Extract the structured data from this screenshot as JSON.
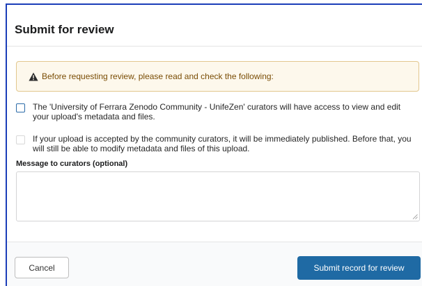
{
  "modal": {
    "title": "Submit for review"
  },
  "warning": {
    "icon": "warning-triangle-icon",
    "text": "Before requesting review, please read and check the following:",
    "colors": {
      "background": "#fdf8ec",
      "border": "#e2c78e",
      "text": "#7a4d05"
    }
  },
  "checks": [
    {
      "text": "The 'University of Ferrara Zenodo Community - UnifeZen' curators will have access to view and edit your upload's metadata and files.",
      "checked": false,
      "enabled": true
    },
    {
      "text": "If your upload is accepted by the community curators, it will be immediately published. Before that, you will still be able to modify metadata and files of this upload.",
      "checked": false,
      "enabled": false
    }
  ],
  "message": {
    "label": "Message to curators (optional)",
    "value": ""
  },
  "footer": {
    "cancel_label": "Cancel",
    "submit_label": "Submit record for review",
    "submit_color": "#1f6aa4"
  }
}
